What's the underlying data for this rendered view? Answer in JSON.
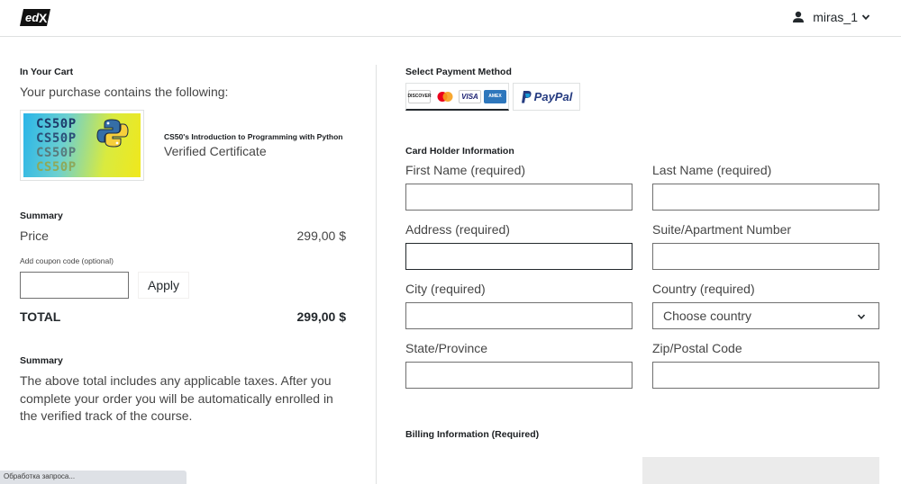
{
  "header": {
    "logo_text": "edX",
    "username": "miras_1"
  },
  "cart": {
    "heading": "In Your Cart",
    "intro": "Your purchase contains the following:",
    "product": {
      "image_lines": [
        "CS50P",
        "CS50P",
        "CS50P",
        "CS50P"
      ],
      "title": "CS50's Introduction to Programming with Python",
      "type": "Verified Certificate"
    }
  },
  "summary": {
    "heading": "Summary",
    "price_label": "Price",
    "price_value": "299,00 $",
    "coupon_label": "Add coupon code (optional)",
    "coupon_value": "",
    "apply_label": "Apply",
    "total_label": "TOTAL",
    "total_value": "299,00 $"
  },
  "summary_note": {
    "heading": "Summary",
    "text": "The above total includes any applicable taxes. After you complete your order you will be automatically enrolled in the verified track of the course."
  },
  "payment": {
    "heading": "Select Payment Method",
    "methods": [
      {
        "name": "card",
        "icons": [
          "DISCOVER",
          "mastercard",
          "VISA",
          "AMEX"
        ],
        "selected": true
      },
      {
        "name": "paypal",
        "label": "PayPal",
        "selected": false
      }
    ]
  },
  "card_holder": {
    "heading": "Card Holder Information",
    "fields": {
      "first_name": {
        "label": "First Name (required)",
        "value": ""
      },
      "last_name": {
        "label": "Last Name (required)",
        "value": ""
      },
      "address": {
        "label": "Address (required)",
        "value": ""
      },
      "suite": {
        "label": "Suite/Apartment Number",
        "value": ""
      },
      "city": {
        "label": "City (required)",
        "value": ""
      },
      "country": {
        "label": "Country (required)",
        "selected": "Choose country"
      },
      "state": {
        "label": "State/Province",
        "value": ""
      },
      "zip": {
        "label": "Zip/Postal Code",
        "value": ""
      }
    }
  },
  "billing": {
    "heading": "Billing Information (Required)"
  },
  "status_bar": {
    "text": "Обработка запроса..."
  },
  "colors": {
    "text_dark": "#23282c",
    "text_body": "#454545",
    "border": "#707070",
    "divider": "#dfe1e1",
    "paypal_dark": "#253b80",
    "paypal_light": "#179bd7"
  }
}
